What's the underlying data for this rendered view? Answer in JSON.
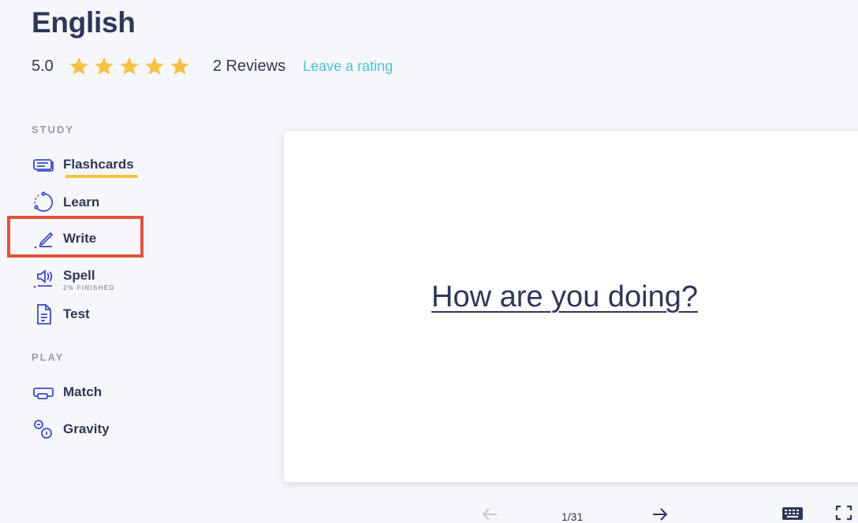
{
  "set": {
    "title": "English",
    "rating": "5.0",
    "stars_filled": 5,
    "stars_total": 5,
    "reviews": "2 Reviews",
    "leave_rating": "Leave a rating"
  },
  "sidebar": {
    "study_label": "STUDY",
    "play_label": "PLAY",
    "study_items": [
      {
        "label": "Flashcards",
        "icon": "flashcards-icon"
      },
      {
        "label": "Learn",
        "icon": "learn-icon"
      },
      {
        "label": "Write",
        "icon": "write-icon"
      },
      {
        "label": "Spell",
        "icon": "spell-icon",
        "sub": "2% FINISHED"
      },
      {
        "label": "Test",
        "icon": "test-icon"
      }
    ],
    "play_items": [
      {
        "label": "Match",
        "icon": "match-icon"
      },
      {
        "label": "Gravity",
        "icon": "gravity-icon"
      }
    ]
  },
  "card": {
    "text": "How are you doing?"
  },
  "controls": {
    "counter": "1/31"
  },
  "colors": {
    "accent_yellow": "#f6c244",
    "link_teal": "#4bc4d8",
    "icon_blue": "#3b4bc9",
    "highlight_red": "#e0523f"
  }
}
